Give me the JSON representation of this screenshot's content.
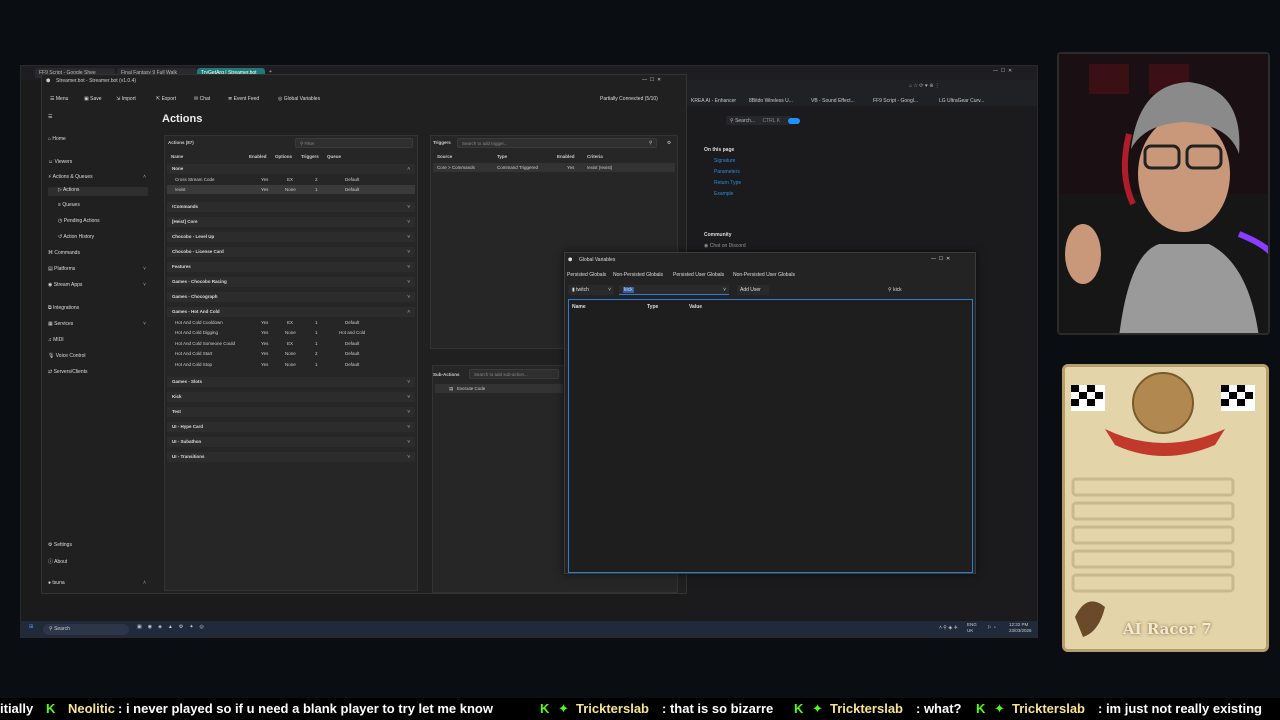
{
  "browser": {
    "tabs": [
      "FF9 Script - Google Shee",
      "Final Fantasy 9 Full Walk",
      "TryGetArg | Streamer.bot"
    ],
    "bookmarks": [
      "KREA AI - Enhancer",
      "8Bitdo Wireless U...",
      "VB - Sound Effect...",
      "FF9 Script - Googl...",
      "LG UltraGear Curv..."
    ],
    "doc_search": "Search...",
    "doc_search_shortcut": "CTRL K",
    "on_this_page": "On this page",
    "toc": [
      "Signature",
      "Parameters",
      "Return Type",
      "Example"
    ],
    "community": "Community",
    "discord": "Chat on Discord"
  },
  "app": {
    "title": "Streamer.bot - Streamer.bot (v1.0.4)",
    "connection": "Partially Connected (5/10)",
    "toolbar": [
      "Menu",
      "Save",
      "Import",
      "Export",
      "Chat",
      "Event Feed",
      "Global Variables"
    ],
    "sidebar": {
      "home": "Home",
      "viewers": "Viewers",
      "actions_queues": "Actions & Queues",
      "sub": [
        "Actions",
        "Queues",
        "Pending Actions",
        "Action History"
      ],
      "items": [
        "Commands",
        "Platforms",
        "Stream Apps",
        "Integrations",
        "Services",
        "MIDI",
        "Voice Control",
        "Servers/Clients"
      ],
      "settings": "Settings",
      "about": "About",
      "user": "tsuna"
    },
    "page_title": "Actions"
  },
  "actions": {
    "header": "Actions (87)",
    "filter_placeholder": "Filter",
    "columns": [
      "Name",
      "Enabled",
      "Options",
      "Triggers",
      "Queue"
    ],
    "none_group": "None",
    "none_rows": [
      {
        "name": "Cross Stream Code",
        "enabled": "Yes",
        "options": "EX",
        "triggers": "2",
        "queue": "Default"
      },
      {
        "name": "!exist",
        "enabled": "Yes",
        "options": "None",
        "triggers": "1",
        "queue": "Default"
      }
    ],
    "groups_a": [
      "!Commands",
      "[Heist] Core",
      "Chocobo - Level Up",
      "Chocobo - License Card",
      "Features",
      "Games - Chocobo Racing",
      "Games - Chocograph"
    ],
    "hot_group": "Games - Hot And Cold",
    "hot_rows": [
      {
        "name": "Hot And Cold Cooldown",
        "enabled": "Yes",
        "options": "EX",
        "triggers": "1",
        "queue": "Default"
      },
      {
        "name": "Hot And Cold Digging",
        "enabled": "Yes",
        "options": "None",
        "triggers": "1",
        "queue": "Hot and Cold"
      },
      {
        "name": "Hot And Cold Someone Could",
        "enabled": "Yes",
        "options": "EX",
        "triggers": "1",
        "queue": "Default"
      },
      {
        "name": "Hot And Cold Start",
        "enabled": "Yes",
        "options": "None",
        "triggers": "2",
        "queue": "Default"
      },
      {
        "name": "Hot And Cold Stop",
        "enabled": "Yes",
        "options": "None",
        "triggers": "1",
        "queue": "Default"
      }
    ],
    "groups_b": [
      "Games - Slots",
      "Kick",
      "Test",
      "UI - Hype Card",
      "UI - Subathon",
      "UI - Transitions"
    ]
  },
  "triggers": {
    "title": "Triggers",
    "search": "Search to add trigger...",
    "columns": [
      "Source",
      "Type",
      "Enabled",
      "Criteria"
    ],
    "rows": [
      {
        "source": "Core > Commands",
        "type": "Command Triggered",
        "enabled": "Yes",
        "criteria": "!exist (!exist)"
      }
    ]
  },
  "subactions": {
    "title": "Sub-Actions",
    "search": "Search to add sub-action...",
    "item": "Execute Code"
  },
  "global_vars": {
    "title": "Global Variables",
    "tabs": [
      "Persisted Globals",
      "Non-Persisted Globals",
      "Persisted User Globals",
      "Non-Persisted User Globals"
    ],
    "platform": "twitch",
    "user_value": "kick",
    "add_user": "Add User",
    "search_value": "kick",
    "columns": [
      "Name",
      "Type",
      "Value"
    ]
  },
  "taskbar": {
    "search": "Search",
    "lang": "ENG",
    "region": "UK",
    "time": "12:32 PM",
    "date": "23/03/2026"
  },
  "card": {
    "name": "AI Racer 7",
    "accent": "#c0392b"
  },
  "ticker": [
    {
      "user": "",
      "text": "itially"
    },
    {
      "user": "Neolitic",
      "text": ": i never played so if u need a blank player to try let me know"
    },
    {
      "user": "Trickterslab",
      "text": ": that is so bizarre"
    },
    {
      "user": "Trickterslab",
      "text": ": what?"
    },
    {
      "user": "Trickterslab",
      "text": ": im just not really existing"
    }
  ],
  "colors": {
    "kick": "#53fc18",
    "accent_blue": "#2e7bd6",
    "teal_tab": "#1f7a77"
  }
}
